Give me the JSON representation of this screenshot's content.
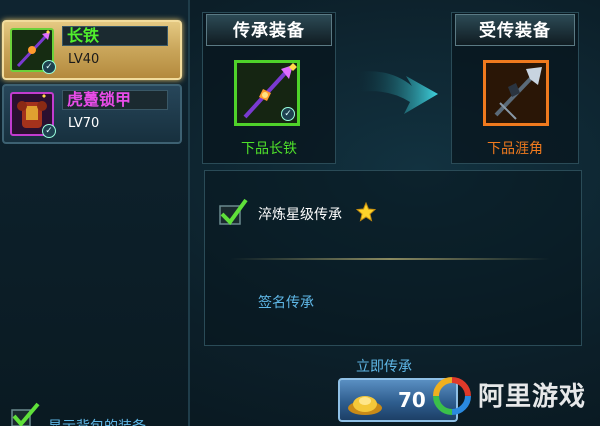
{
  "inventory": {
    "items": [
      {
        "name": "长铁",
        "level": "LV40",
        "icon": "spear-icon",
        "quality_color": "#51f02c",
        "selected": true
      },
      {
        "name": "虎躉锁甲",
        "level": "LV70",
        "icon": "armor-icon",
        "quality_color": "#e94ce8",
        "selected": false
      }
    ],
    "show_bag_label": "显示背包的装备"
  },
  "source": {
    "title": "传承装备",
    "item_name": "下品长铁",
    "icon": "spear-icon",
    "quality_color": "#4fe02a"
  },
  "target": {
    "title": "受传装备",
    "item_name": "下品涯角",
    "icon": "halberd-icon",
    "quality_color": "#f07a1e"
  },
  "options": {
    "star_inherit_label": "淬炼星级传承",
    "star_inherit_checked": true,
    "sign_inherit_label": "签名传承"
  },
  "action": {
    "label": "立即传承",
    "cost": "70",
    "currency_icon": "gold-ingot-icon"
  },
  "watermark": {
    "text": "阿里游戏"
  }
}
